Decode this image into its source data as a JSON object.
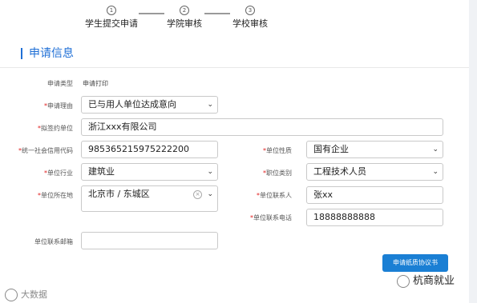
{
  "steps": [
    {
      "num": "1",
      "label": "学生提交申请"
    },
    {
      "num": "2",
      "label": "学院审核"
    },
    {
      "num": "3",
      "label": "学校审核"
    }
  ],
  "section_title": "申请信息",
  "form": {
    "apply_type_label": "申请类型",
    "apply_type_value": "申请打印",
    "reason_label": "申请理由",
    "reason_value": "已与用人单位达成意向",
    "company_label": "拟签约单位",
    "company_value": "浙江xxx有限公司",
    "credit_code_label": "统一社会信用代码",
    "credit_code_value": "985365215975222200",
    "unit_nature_label": "单位性质",
    "unit_nature_value": "国有企业",
    "industry_label": "单位行业",
    "industry_value": "建筑业",
    "job_category_label": "职位类别",
    "job_category_value": "工程技术人员",
    "location_label": "单位所在地",
    "location_value": "北京市 / 东城区",
    "contact_label": "单位联系人",
    "contact_value": "张xx",
    "phone_label": "单位联系电话",
    "phone_value": "18888888888",
    "email_label": "单位联系邮箱",
    "email_value": "",
    "required_mark": "*"
  },
  "submit_button": "申请纸质协议书",
  "watermark_left": "大数据",
  "watermark_right": "杭商就业",
  "colors": {
    "accent": "#1a7fd4",
    "required": "#e02020"
  },
  "icons": {
    "dropdown": "chevron-down-icon",
    "clear": "clear-icon"
  }
}
